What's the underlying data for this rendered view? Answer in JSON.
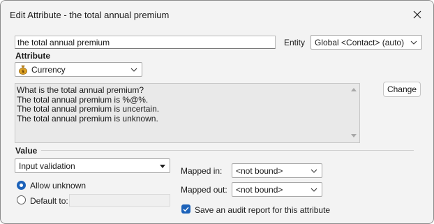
{
  "window": {
    "title": "Edit Attribute - the total annual premium"
  },
  "attribute_name": {
    "value": "the total annual premium"
  },
  "entity": {
    "label": "Entity",
    "selected": "Global <Contact> (auto)"
  },
  "attribute": {
    "heading": "Attribute",
    "type_selected": "Currency",
    "type_icon": "money-bag-icon"
  },
  "text_forms": {
    "lines": [
      "What is the total annual premium?",
      "The total annual premium is %@%.",
      "The total annual premium is uncertain.",
      "The total annual premium is unknown."
    ]
  },
  "change_button": {
    "label": "Change"
  },
  "value_section": {
    "heading": "Value",
    "validation_selected": "Input validation",
    "allow_unknown_label": "Allow unknown",
    "allow_unknown_checked": true,
    "default_to_label": "Default to:",
    "default_to_value": ""
  },
  "mapping": {
    "mapped_in_label": "Mapped in:",
    "mapped_in_selected": "<not bound>",
    "mapped_out_label": "Mapped out:",
    "mapped_out_selected": "<not bound>"
  },
  "audit": {
    "label": "Save an audit report for this attribute",
    "checked": true
  },
  "colors": {
    "accent": "#1c62b9",
    "window_bg": "#f3f3f3",
    "text_area_bg": "#e9e9e9"
  }
}
